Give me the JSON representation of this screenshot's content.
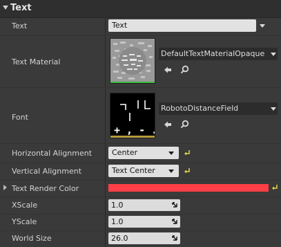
{
  "section": {
    "title": "Text"
  },
  "rows": {
    "text": {
      "label": "Text",
      "value": "Text"
    },
    "text_material": {
      "label": "Text Material",
      "asset_name": "DefaultTextMaterialOpaque"
    },
    "font": {
      "label": "Font",
      "asset_name": "RobotoDistanceField",
      "preview_glyphs": "+ , - . /"
    },
    "horizontal_alignment": {
      "label": "Horizontal Alignment",
      "value": "Center"
    },
    "vertical_alignment": {
      "label": "Vertical Alignment",
      "value": "Text Center"
    },
    "text_render_color": {
      "label": "Text Render Color",
      "color": "#ff3f46"
    },
    "xscale": {
      "label": "XScale",
      "value": "1.0"
    },
    "yscale": {
      "label": "YScale",
      "value": "1.0"
    },
    "world_size": {
      "label": "World Size",
      "value": "26.0"
    }
  },
  "icons": {
    "use_selected": "arrow-left-icon",
    "browse": "search-icon",
    "reset_to_default": "reset-arrow-icon",
    "drag_grip": "diagonal-grip-icon"
  },
  "colors": {
    "material_underline": "#3dbb3d",
    "font_underline": "#b59a3a",
    "reset_arrow": "#e8d84a"
  }
}
